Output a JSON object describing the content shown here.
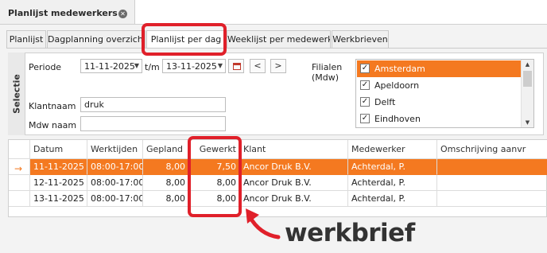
{
  "window": {
    "title": "Planlijst medewerkers"
  },
  "tabs": [
    {
      "label": "Planlijst"
    },
    {
      "label": "Dagplanning overzicht"
    },
    {
      "label": "Planlijst per dag"
    },
    {
      "label": "Weeklijst per medewerker"
    },
    {
      "label": "Werkbrieven"
    }
  ],
  "selection": {
    "title": "Selectie",
    "periode_label": "Periode",
    "date_from": "11-11-2025",
    "tm_label": "t/m",
    "date_to": "13-11-2025",
    "prev_label": "<",
    "next_label": ">",
    "klantnaam_label": "Klantnaam",
    "klantnaam_value": "druk",
    "mdw_label": "Mdw naam",
    "mdw_value": "",
    "filialen_label": "Filialen",
    "filialen_sub": "(Mdw)",
    "filialen": [
      {
        "name": "Amsterdam",
        "checked": true,
        "selected": true
      },
      {
        "name": "Apeldoorn",
        "checked": true,
        "selected": false
      },
      {
        "name": "Delft",
        "checked": true,
        "selected": false
      },
      {
        "name": "Eindhoven",
        "checked": true,
        "selected": false
      }
    ]
  },
  "grid": {
    "columns": [
      "Datum",
      "Werktijden",
      "Gepland",
      "Gewerkt",
      "Klant",
      "Medewerker",
      "Omschrijving aanvr"
    ],
    "rows": [
      [
        "11-11-2025",
        "08:00-17:00",
        "8,00",
        "7,50",
        "Ancor Druk B.V.",
        "Achterdal, P.",
        ""
      ],
      [
        "12-11-2025",
        "08:00-17:00",
        "8,00",
        "8,00",
        "Ancor Druk B.V.",
        "Achterdal, P.",
        ""
      ],
      [
        "13-11-2025",
        "08:00-17:00",
        "8,00",
        "8,00",
        "Ancor Druk B.V.",
        "Achterdal, P.",
        ""
      ]
    ],
    "current_row_indicator": "→"
  },
  "annotation": {
    "label": "werkbrief"
  },
  "colors": {
    "accent": "#f47920",
    "annotation": "#e0202a"
  }
}
